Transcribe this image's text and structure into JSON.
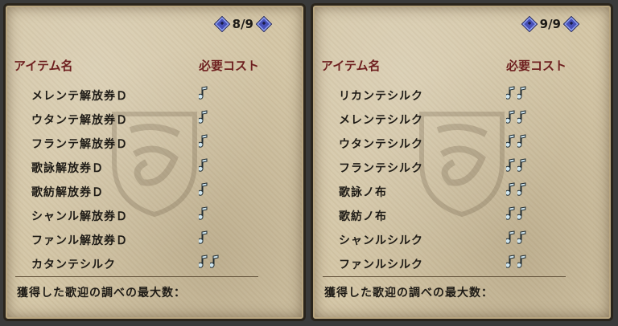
{
  "left_panel": {
    "page": "8/9",
    "header": {
      "name_label": "アイテム名",
      "cost_label": "必要コスト"
    },
    "items": [
      {
        "name": "メレンテ解放券Ｄ",
        "cost": 1
      },
      {
        "name": "ウタンテ解放券Ｄ",
        "cost": 1
      },
      {
        "name": "フランテ解放券Ｄ",
        "cost": 1
      },
      {
        "name": "歌詠解放券Ｄ",
        "cost": 1
      },
      {
        "name": "歌紡解放券Ｄ",
        "cost": 1
      },
      {
        "name": "シャンル解放券Ｄ",
        "cost": 1
      },
      {
        "name": "ファンル解放券Ｄ",
        "cost": 1
      },
      {
        "name": "カタンテシルク",
        "cost": 2
      }
    ],
    "footer": "獲得した歌迎の調べの最大数："
  },
  "right_panel": {
    "page": "9/9",
    "header": {
      "name_label": "アイテム名",
      "cost_label": "必要コスト"
    },
    "items": [
      {
        "name": "リカンテシルク",
        "cost": 2
      },
      {
        "name": "メレンテシルク",
        "cost": 2
      },
      {
        "name": "ウタンテシルク",
        "cost": 2
      },
      {
        "name": "フランテシルク",
        "cost": 2
      },
      {
        "name": "歌詠ノ布",
        "cost": 2
      },
      {
        "name": "歌紡ノ布",
        "cost": 2
      },
      {
        "name": "シャンルシルク",
        "cost": 2
      },
      {
        "name": "ファンルシルク",
        "cost": 2
      }
    ],
    "footer": "獲得した歌迎の調べの最大数："
  },
  "icons": {
    "cost_icon": "music-note-icon",
    "page_prev": "diamond-left-arrow-icon",
    "page_next": "diamond-right-arrow-icon",
    "watermark": "guild-emblem-icon"
  },
  "colors": {
    "header_text": "#6e1f1f",
    "body_text": "#1e1b16",
    "parchment": "#d4c6a6",
    "note_fill": "#cfe6f0",
    "arrow": "#4750b8"
  }
}
